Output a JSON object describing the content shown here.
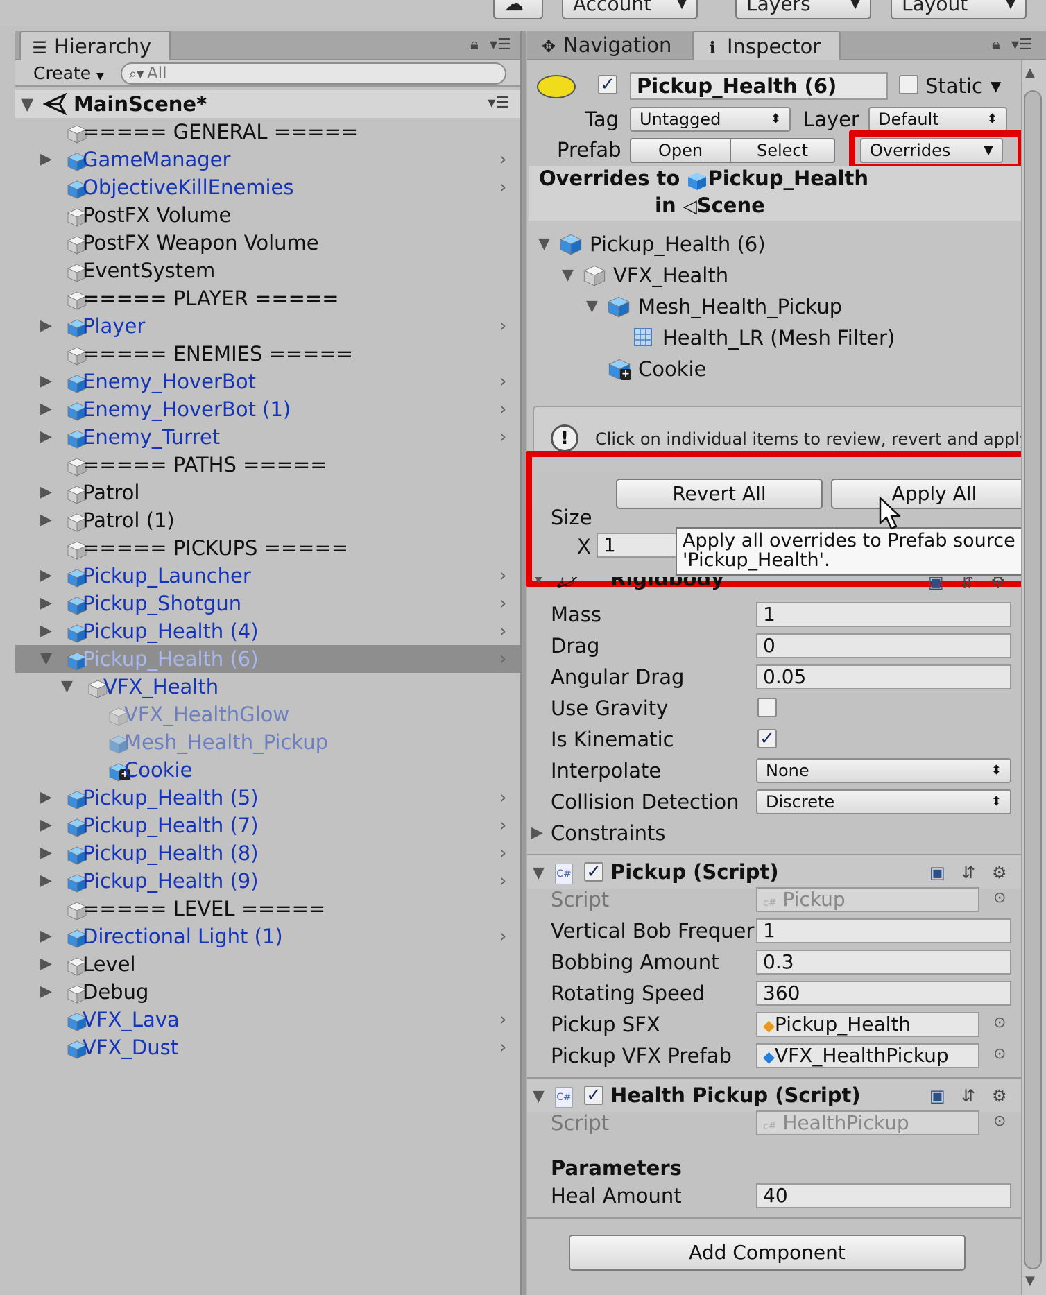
{
  "toolbar": {
    "account_label": "Account",
    "layers_label": "Layers",
    "layout_label": "Layout"
  },
  "hierarchy": {
    "tab_label": "Hierarchy",
    "create_label": "Create",
    "search_placeholder": "All",
    "scene_name": "MainScene*",
    "items": [
      {
        "label": "===== GENERAL =====",
        "style": "plain"
      },
      {
        "label": "GameManager",
        "style": "prefab",
        "expand": true,
        "more": true
      },
      {
        "label": "ObjectiveKillEnemies",
        "style": "prefab",
        "more": true
      },
      {
        "label": "PostFX Volume",
        "style": "plain"
      },
      {
        "label": "PostFX Weapon Volume",
        "style": "plain"
      },
      {
        "label": "EventSystem",
        "style": "plain"
      },
      {
        "label": "===== PLAYER =====",
        "style": "plain"
      },
      {
        "label": "Player",
        "style": "prefab",
        "expand": true,
        "more": true
      },
      {
        "label": "===== ENEMIES =====",
        "style": "plain"
      },
      {
        "label": "Enemy_HoverBot",
        "style": "prefab",
        "expand": true,
        "more": true
      },
      {
        "label": "Enemy_HoverBot (1)",
        "style": "prefab",
        "expand": true,
        "more": true
      },
      {
        "label": "Enemy_Turret",
        "style": "prefab",
        "expand": true,
        "more": true
      },
      {
        "label": "===== PATHS =====",
        "style": "plain"
      },
      {
        "label": "Patrol",
        "style": "plain",
        "expand": true
      },
      {
        "label": "Patrol (1)",
        "style": "plain",
        "expand": true
      },
      {
        "label": "===== PICKUPS =====",
        "style": "plain"
      },
      {
        "label": "Pickup_Launcher",
        "style": "prefab",
        "expand": true,
        "more": true
      },
      {
        "label": "Pickup_Shotgun",
        "style": "prefab",
        "expand": true,
        "more": true
      },
      {
        "label": "Pickup_Health (4)",
        "style": "prefab",
        "expand": true,
        "more": true
      },
      {
        "label": "Pickup_Health (6)",
        "style": "selected",
        "expand": true,
        "open": true,
        "more": true
      },
      {
        "label": "VFX_Health",
        "style": "prefab",
        "indent": 1,
        "expand": true,
        "open": true,
        "plaincube": true
      },
      {
        "label": "VFX_HealthGlow",
        "style": "faded",
        "indent": 2,
        "plaincube": true
      },
      {
        "label": "Mesh_Health_Pickup",
        "style": "faded",
        "indent": 2
      },
      {
        "label": "Cookie",
        "style": "prefab",
        "indent": 2,
        "added": true
      },
      {
        "label": "Pickup_Health (5)",
        "style": "prefab",
        "expand": true,
        "more": true
      },
      {
        "label": "Pickup_Health (7)",
        "style": "prefab",
        "expand": true,
        "more": true
      },
      {
        "label": "Pickup_Health (8)",
        "style": "prefab",
        "expand": true,
        "more": true
      },
      {
        "label": "Pickup_Health (9)",
        "style": "prefab",
        "expand": true,
        "more": true
      },
      {
        "label": "===== LEVEL =====",
        "style": "plain"
      },
      {
        "label": "Directional Light (1)",
        "style": "prefab",
        "expand": true,
        "more": true
      },
      {
        "label": "Level",
        "style": "plain",
        "expand": true
      },
      {
        "label": "Debug",
        "style": "plain",
        "expand": true
      },
      {
        "label": "VFX_Lava",
        "style": "prefab",
        "more": true
      },
      {
        "label": "VFX_Dust",
        "style": "prefab",
        "more": true
      }
    ]
  },
  "tabs": {
    "navigation_label": "Navigation",
    "inspector_label": "Inspector"
  },
  "inspector": {
    "object_name": "Pickup_Health (6)",
    "static_label": "Static",
    "tag_label": "Tag",
    "tag_value": "Untagged",
    "layer_label": "Layer",
    "layer_value": "Default",
    "prefab_label": "Prefab",
    "open_label": "Open",
    "select_label": "Select",
    "overrides_label": "Overrides",
    "overrides_popup": {
      "title_line1_prefix": "Overrides to",
      "title_line1_name": "Pickup_Health",
      "title_line2_prefix": "in",
      "title_line2_name": "Scene",
      "tree": [
        {
          "label": "Pickup_Health (6)"
        },
        {
          "label": "VFX_Health"
        },
        {
          "label": "Mesh_Health_Pickup"
        },
        {
          "label": "Health_LR (Mesh Filter)"
        },
        {
          "label": "Cookie"
        }
      ],
      "info_text": "Click on individual items to review, revert and apply.",
      "revert_all_label": "Revert All",
      "apply_all_label": "Apply All",
      "tooltip_line1": "Apply all overrides to Prefab source",
      "tooltip_line2": "'Pickup_Health'."
    },
    "partial_size_label": "Size",
    "partial_x_label": "X",
    "partial_x_value": "1",
    "rigidbody": {
      "title": "Rigidbody",
      "mass_label": "Mass",
      "mass_value": "1",
      "drag_label": "Drag",
      "drag_value": "0",
      "angular_drag_label": "Angular Drag",
      "angular_drag_value": "0.05",
      "use_gravity_label": "Use Gravity",
      "use_gravity": false,
      "is_kinematic_label": "Is Kinematic",
      "is_kinematic": true,
      "interpolate_label": "Interpolate",
      "interpolate_value": "None",
      "collision_label": "Collision Detection",
      "collision_value": "Discrete",
      "constraints_label": "Constraints"
    },
    "pickup_script": {
      "title": "Pickup (Script)",
      "script_label": "Script",
      "script_value": "Pickup",
      "bob_freq_label": "Vertical Bob Frequer",
      "bob_freq_value": "1",
      "bob_amount_label": "Bobbing Amount",
      "bob_amount_value": "0.3",
      "rot_speed_label": "Rotating Speed",
      "rot_speed_value": "360",
      "sfx_label": "Pickup SFX",
      "sfx_value": "Pickup_Health",
      "vfx_label": "Pickup VFX Prefab",
      "vfx_value": "VFX_HealthPickup"
    },
    "health_script": {
      "title": "Health Pickup (Script)",
      "script_label": "Script",
      "script_value": "HealthPickup",
      "params_label": "Parameters",
      "heal_label": "Heal Amount",
      "heal_value": "40"
    },
    "add_component_label": "Add Component"
  },
  "icons": {
    "cs_badge": "C#"
  },
  "colors": {
    "prefab_text": "#1535b8",
    "highlight_red": "#e00000",
    "selection_bg": "#8e8e8e"
  }
}
